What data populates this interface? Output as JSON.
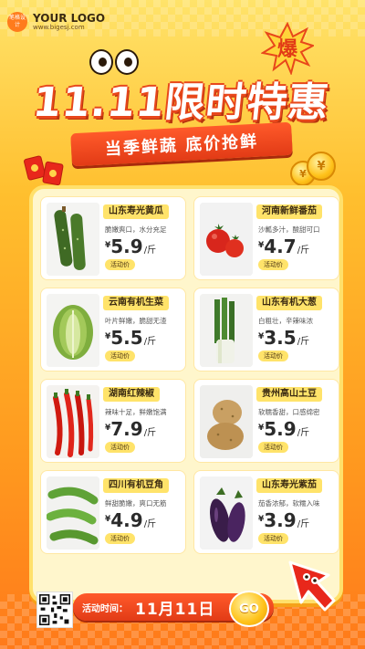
{
  "logo": {
    "mark": "笔格设计",
    "name": "YOUR LOGO",
    "url": "www.bigesj.com"
  },
  "burst_text": "爆",
  "headline": "11.11限时特惠",
  "subtitle": "当季鲜蔬 底价抢鲜",
  "coin_glyph": "¥",
  "currency": "¥",
  "products": [
    {
      "name": "山东寿光黄瓜",
      "desc": "脆嫩爽口，水分充足",
      "price": "5.9",
      "unit": "/斤",
      "badge": "活动价",
      "icon": "cucumber-image"
    },
    {
      "name": "河南新鲜番茄",
      "desc": "沙瓤多汁，酸甜可口",
      "price": "4.7",
      "unit": "/斤",
      "badge": "活动价",
      "icon": "tomato-image"
    },
    {
      "name": "云南有机生菜",
      "desc": "叶片鲜嫩，脆甜无渣",
      "price": "5.5",
      "unit": "/斤",
      "badge": "活动价",
      "icon": "lettuce-image"
    },
    {
      "name": "山东有机大葱",
      "desc": "白粗壮，辛辣味浓",
      "price": "3.5",
      "unit": "/斤",
      "badge": "活动价",
      "icon": "scallion-image"
    },
    {
      "name": "湖南红辣椒",
      "desc": "辣味十足，鲜嫩饱满",
      "price": "7.9",
      "unit": "/斤",
      "badge": "活动价",
      "icon": "chili-image"
    },
    {
      "name": "贵州高山土豆",
      "desc": "软糯香甜，口感绵密",
      "price": "5.9",
      "unit": "/斤",
      "badge": "活动价",
      "icon": "potato-image"
    },
    {
      "name": "四川有机豆角",
      "desc": "鲜甜脆嫩，爽口无筋",
      "price": "4.9",
      "unit": "/斤",
      "badge": "活动价",
      "icon": "pea-pod-image"
    },
    {
      "name": "山东寿光紫茄",
      "desc": "茄香浓郁，软糯入味",
      "price": "3.9",
      "unit": "/斤",
      "badge": "活动价",
      "icon": "eggplant-image"
    }
  ],
  "event": {
    "label": "活动时间：",
    "date": "11月11日",
    "go": "GO"
  },
  "colors": {
    "accent": "#e23b16",
    "highlight": "#ffe36a",
    "background_top": "#ffe36a",
    "background_bottom": "#ff7a1a"
  }
}
